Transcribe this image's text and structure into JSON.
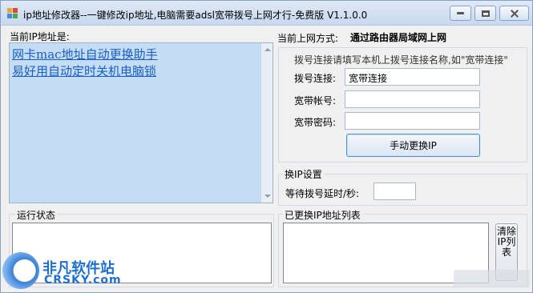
{
  "window": {
    "title": "ip地址修改器--一键修改ip地址,电脑需要adsl宽带拨号上网才行-免费版 V1.1.0.0",
    "controls": {
      "minimize_icon": "minimize-icon",
      "maximize_icon": "maximize-icon",
      "close_icon": "close-icon"
    }
  },
  "current_ip": {
    "label": "当前IP地址是:",
    "links": [
      "网卡mac地址自动更换助手",
      "易好用自动定时关机电脑锁"
    ]
  },
  "connection": {
    "method_label": "当前上网方式:",
    "method_value": "通过路由器局域网上网",
    "hint": "拨号连接请填写本机上拨号连接名称,如\"宽带连接\"",
    "dial_label": "拨号连接:",
    "dial_value": "宽带连接",
    "account_label": "宽带帐号:",
    "account_value": "",
    "password_label": "宽带密码:",
    "password_value": "",
    "change_button": "手动更换IP"
  },
  "settings": {
    "group_title": "换IP设置",
    "delay_label": "等待拨号延时/秒:",
    "delay_value": ""
  },
  "status": {
    "title": "运行状态"
  },
  "changed_list": {
    "title": "已更换IP地址列表",
    "clear_button": "清除IP列表"
  },
  "watermark": {
    "name": "非凡软件站",
    "site": "CRSKY.com"
  }
}
